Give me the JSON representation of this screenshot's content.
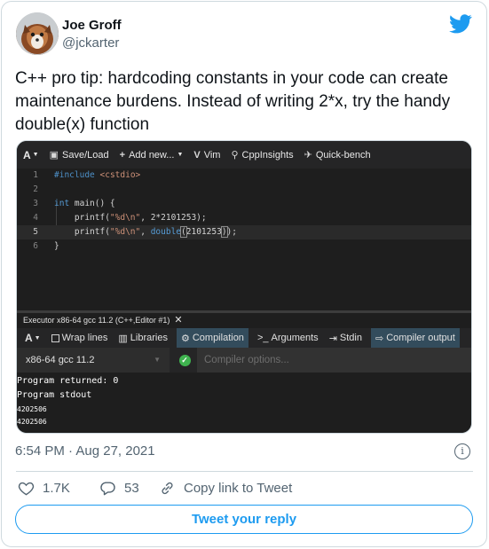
{
  "author": {
    "name": "Joe Groff",
    "handle": "@jckarter"
  },
  "tweet": {
    "line1": "C++ pro tip: hardcoding constants in your code can create",
    "line2": "maintenance burdens. Instead of writing 2*x, try the handy",
    "line3": "double(x) function"
  },
  "toolbar": {
    "font": "A",
    "save": "Save/Load",
    "add": "Add new...",
    "vim": "Vim",
    "cppinsights": "CppInsights",
    "quickbench": "Quick-bench"
  },
  "editor": {
    "lines": [
      {
        "n": "1",
        "text": "#include <cstdio>"
      },
      {
        "n": "2",
        "text": ""
      },
      {
        "n": "3",
        "text": "int main() {"
      },
      {
        "n": "4",
        "text": "    printf(\"%d\\n\", 2*2101253);"
      },
      {
        "n": "5",
        "text": "    printf(\"%d\\n\", double(2101253));"
      },
      {
        "n": "6",
        "text": "}"
      }
    ],
    "active_line": "5"
  },
  "executor": {
    "title": "Executor x86-64 gcc 11.2 (C++,Editor #1)",
    "close": "✕",
    "font": "A",
    "wrap": "Wrap lines",
    "libraries": "Libraries",
    "compilation": "Compilation",
    "arguments": "Arguments",
    "stdin": "Stdin",
    "compiler_output": "Compiler output",
    "compiler": "x86-64 gcc 11.2",
    "options_placeholder": "Compiler options...",
    "output": [
      "Program returned: 0",
      "Program stdout",
      "4202506",
      "4202506"
    ]
  },
  "meta": {
    "time": "6:54 PM · Aug 27, 2021"
  },
  "actions": {
    "likes": "1.7K",
    "replies": "53",
    "copy": "Copy link to Tweet"
  },
  "reply_button": "Tweet your reply",
  "colors": {
    "twitter_blue": "#1d9bf0",
    "editor_bg": "#1e1e1e",
    "active_tab": "#334c5c",
    "ok_green": "#3fb34f"
  },
  "icons": [
    "twitter-bird-icon",
    "save-icon",
    "plus-icon",
    "vim-icon",
    "search-icon",
    "pin-icon",
    "check-icon",
    "info-icon",
    "heart-icon",
    "reply-icon",
    "link-icon"
  ]
}
